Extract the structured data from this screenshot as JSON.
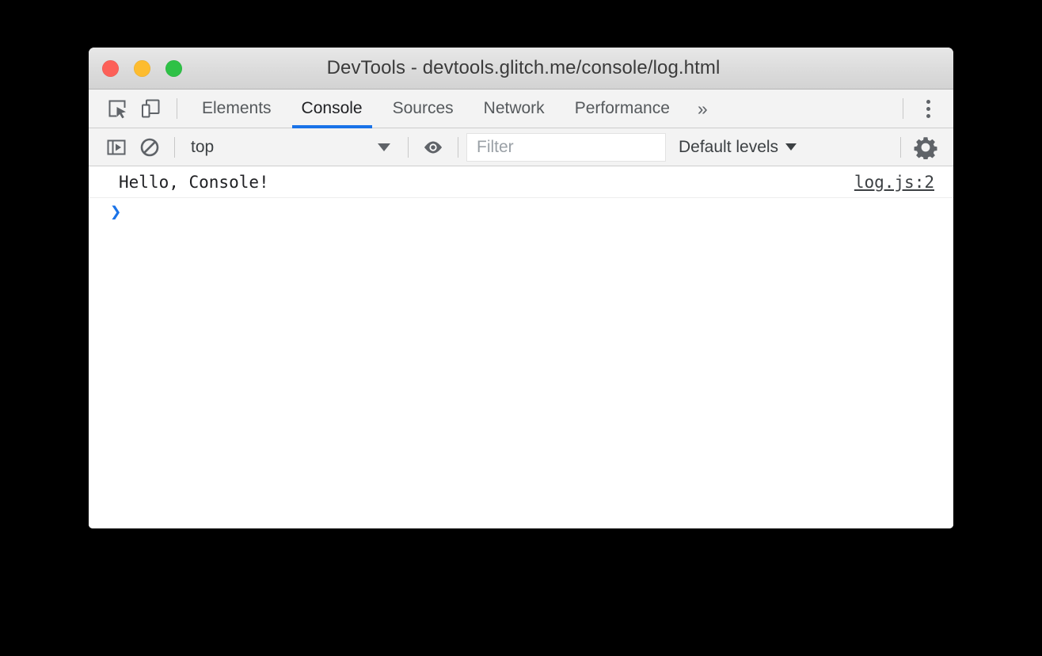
{
  "window": {
    "title": "DevTools - devtools.glitch.me/console/log.html",
    "traffic_lights": [
      {
        "name": "close",
        "color": "#fc6058"
      },
      {
        "name": "minimize",
        "color": "#fdbc2f"
      },
      {
        "name": "maximize",
        "color": "#2ec146"
      }
    ]
  },
  "accent_color": "#1a73e8",
  "tabbar": {
    "left_icons": [
      {
        "icon": "inspect-element-icon",
        "label": "Inspect element"
      },
      {
        "icon": "device-toolbar-icon",
        "label": "Toggle device toolbar"
      }
    ],
    "tabs": [
      {
        "label": "Elements",
        "active": false
      },
      {
        "label": "Console",
        "active": true
      },
      {
        "label": "Sources",
        "active": false
      },
      {
        "label": "Network",
        "active": false
      },
      {
        "label": "Performance",
        "active": false
      }
    ],
    "overflow_label": "»",
    "menu_icon": "more-options-icon"
  },
  "console_toolbar": {
    "sidebar_icon": "show-console-sidebar-icon",
    "clear_icon": "clear-console-icon",
    "context": {
      "value": "top",
      "caret": "chevron-down-icon"
    },
    "eye_icon": "create-live-expression-icon",
    "filter": {
      "value": "",
      "placeholder": "Filter"
    },
    "levels": {
      "label": "Default levels",
      "caret": "chevron-down-icon"
    },
    "settings_icon": "settings-gear-icon"
  },
  "console": {
    "messages": [
      {
        "text": "Hello, Console!",
        "source": "log.js:2"
      }
    ],
    "prompt": {
      "chevron": "❯",
      "value": ""
    }
  }
}
